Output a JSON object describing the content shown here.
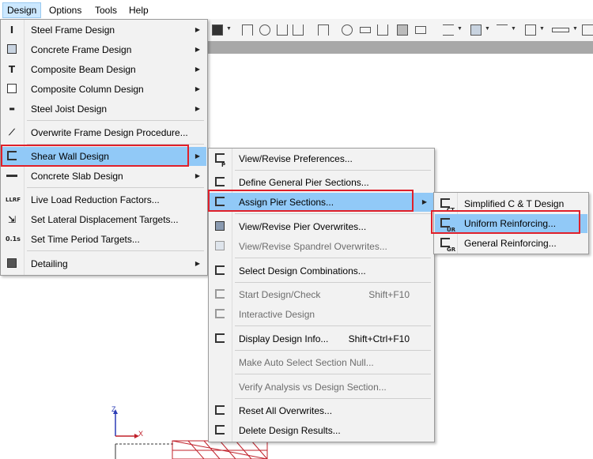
{
  "menubar": {
    "items": [
      {
        "label": "Design"
      },
      {
        "label": "Options"
      },
      {
        "label": "Tools"
      },
      {
        "label": "Help"
      }
    ]
  },
  "design_menu": {
    "items": [
      {
        "label": "Steel Frame Design",
        "icon": "i-beam-icon",
        "submenu": true
      },
      {
        "label": "Concrete Frame Design",
        "icon": "concrete-frame-icon",
        "submenu": true
      },
      {
        "label": "Composite Beam Design",
        "icon": "composite-beam-icon",
        "submenu": true
      },
      {
        "label": "Composite Column Design",
        "icon": "composite-column-icon",
        "submenu": true
      },
      {
        "label": "Steel Joist Design",
        "icon": "steel-joist-icon",
        "submenu": true
      },
      {
        "label": "Overwrite Frame Design Procedure...",
        "icon": "overwrite-procedure-icon",
        "submenu": false
      },
      {
        "label": "Shear Wall Design",
        "icon": "shear-wall-icon",
        "submenu": true
      },
      {
        "label": "Concrete Slab Design",
        "icon": "concrete-slab-icon",
        "submenu": true
      },
      {
        "label": "Live Load Reduction Factors...",
        "icon": "llrf-icon",
        "submenu": false
      },
      {
        "label": "Set Lateral Displacement Targets...",
        "icon": "displacement-target-icon",
        "submenu": false
      },
      {
        "label": "Set Time Period Targets...",
        "icon": "time-period-icon",
        "submenu": false
      },
      {
        "label": "Detailing",
        "icon": "detailing-icon",
        "submenu": true
      }
    ],
    "icon_text": {
      "llrf": "LLRF",
      "time": "0.1s"
    }
  },
  "shear_wall_menu": {
    "items": [
      {
        "label": "View/Revise Preferences...",
        "shortcut": "",
        "tag": "P"
      },
      {
        "label": "Define General Pier Sections...",
        "shortcut": "",
        "tag": ""
      },
      {
        "label": "Assign Pier Sections...",
        "shortcut": "",
        "tag": ""
      },
      {
        "label": "View/Revise Pier Overwrites...",
        "shortcut": "",
        "tag": ""
      },
      {
        "label": "View/Revise Spandrel Overwrites...",
        "shortcut": "",
        "tag": ""
      },
      {
        "label": "Select Design Combinations...",
        "shortcut": "",
        "tag": ""
      },
      {
        "label": "Start Design/Check",
        "shortcut": "Shift+F10",
        "tag": ""
      },
      {
        "label": "Interactive Design",
        "shortcut": "",
        "tag": ""
      },
      {
        "label": "Display Design Info...",
        "shortcut": "Shift+Ctrl+F10",
        "tag": ""
      },
      {
        "label": "Make Auto Select Section Null...",
        "shortcut": "",
        "tag": ""
      },
      {
        "label": "Verify Analysis vs Design Section...",
        "shortcut": "",
        "tag": ""
      },
      {
        "label": "Reset All Overwrites...",
        "shortcut": "",
        "tag": ""
      },
      {
        "label": "Delete Design Results...",
        "shortcut": "",
        "tag": ""
      }
    ]
  },
  "assign_pier_menu": {
    "items": [
      {
        "label": "Simplified C & T Design",
        "tag": "CT"
      },
      {
        "label": "Uniform Reinforcing...",
        "tag": "UR"
      },
      {
        "label": "General Reinforcing...",
        "tag": "GR"
      }
    ]
  },
  "axes": {
    "z": "Z",
    "x": "X"
  },
  "colors": {
    "highlight": "#91c9f7",
    "callout": "#e0202a",
    "menu_bg": "#f2f2f2"
  }
}
